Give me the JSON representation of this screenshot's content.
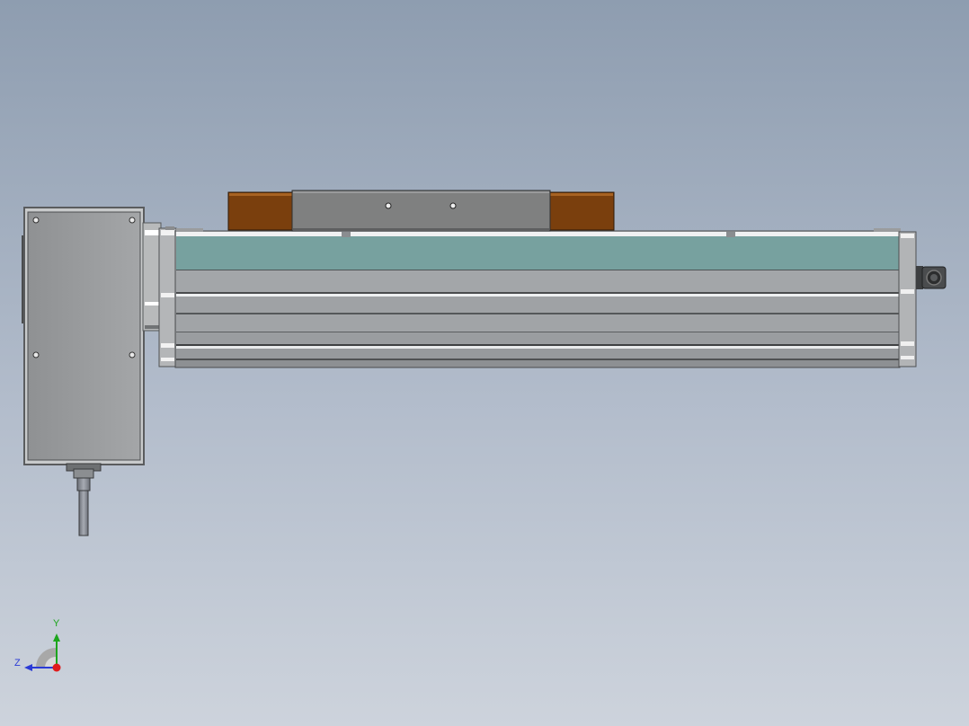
{
  "view": {
    "background_top": "#8e9db0",
    "background_bottom": "#cdd3dc"
  },
  "model": {
    "colors": {
      "profile": "#a7aaad",
      "profile_dark": "#6f7275",
      "cover_strip": "#77a19f",
      "carriage": "#7f8080",
      "carriage_blocks": "#7a3f0d",
      "motor_housing": "#9a9c9e",
      "end_cap": "#c9cbcc"
    }
  },
  "triad": {
    "y_label": "Y",
    "z_label": "Z",
    "colors": {
      "y": "#1ca51c",
      "z": "#2a3ad6",
      "x": "#e01b1b",
      "arc": "#a8a8a8"
    }
  }
}
